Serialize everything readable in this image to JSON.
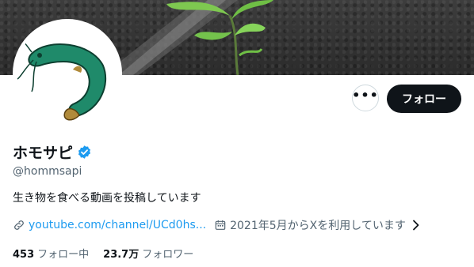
{
  "profile": {
    "display_name": "ホモサピ",
    "handle": "@hommsapi",
    "bio": "生き物を食べる動画を投稿しています",
    "link": "youtube.com/channel/UCd0hs...",
    "joined": "2021年5月からXを利用しています"
  },
  "actions": {
    "follow_label": "フォロー",
    "more_label": "•••"
  },
  "stats": {
    "following_count": "453",
    "following_label": "フォロー中",
    "followers_count": "23.7万",
    "followers_label": "フォロワー"
  },
  "icons": [
    "more-icon",
    "verified-badge-icon",
    "link-icon",
    "calendar-icon",
    "chevron-right-icon"
  ],
  "colors": {
    "accent": "#1d9bf0",
    "button_dark": "#0f1419",
    "secondary_text": "#536471",
    "avatar_fish": "#1f8a6a"
  }
}
